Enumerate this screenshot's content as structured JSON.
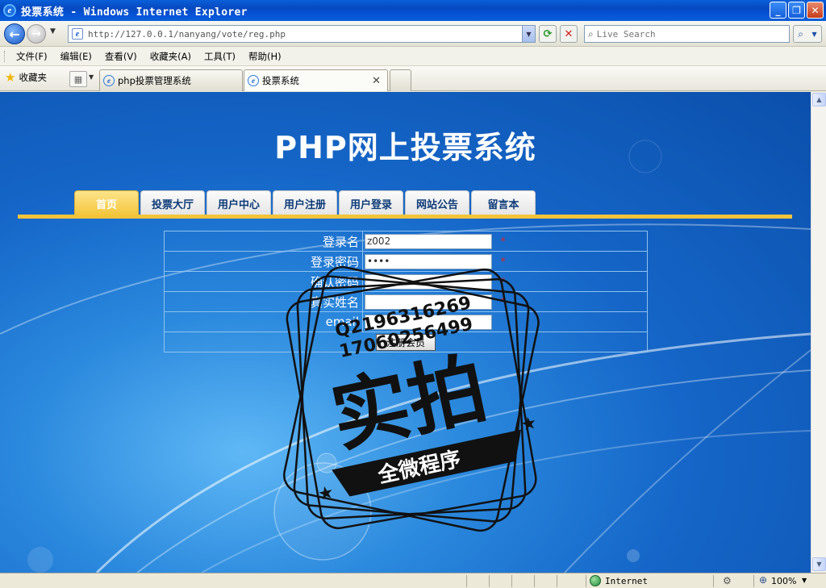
{
  "window": {
    "title": "投票系统 - Windows Internet Explorer",
    "buttons": {
      "minimize": "_",
      "maximize": "❐",
      "close": "✕"
    }
  },
  "address_bar": {
    "url": "http://127.0.0.1/nanyang/vote/reg.php",
    "search_placeholder": "Live Search"
  },
  "menu": {
    "items": [
      "文件(F)",
      "编辑(E)",
      "查看(V)",
      "收藏夹(A)",
      "工具(T)",
      "帮助(H)"
    ]
  },
  "tabs": {
    "favorites_label": "收藏夹",
    "items": [
      {
        "label": "php投票管理系统",
        "active": false
      },
      {
        "label": "投票系统",
        "active": true
      }
    ]
  },
  "site": {
    "title_prefix": "PHP",
    "title_suffix": "网上投票系统",
    "nav": [
      "首页",
      "投票大厅",
      "用户中心",
      "用户注册",
      "用户登录",
      "网站公告",
      "留言本"
    ],
    "form": {
      "fields": [
        {
          "label": "登录名",
          "value": "z002",
          "required_mark": "*"
        },
        {
          "label": "登录密码",
          "value": "••••",
          "required_mark": "*"
        },
        {
          "label": "确认密码",
          "value": "",
          "required_mark": "*"
        },
        {
          "label": "真实姓名",
          "value": "",
          "required_mark": "*"
        },
        {
          "label": "email",
          "value": "",
          "required_mark": ""
        }
      ],
      "submit_label": "注册会员"
    }
  },
  "watermark": {
    "qq_line": "Q2196316269",
    "phone_line": "17060256499",
    "big_text": "实拍",
    "ribbon_text": "全微程序"
  },
  "status": {
    "zone": "Internet",
    "zoom": "100%"
  },
  "colors": {
    "nav_active": "#f3c43a",
    "nav_text": "#0d3b78",
    "required": "#dd2222"
  }
}
